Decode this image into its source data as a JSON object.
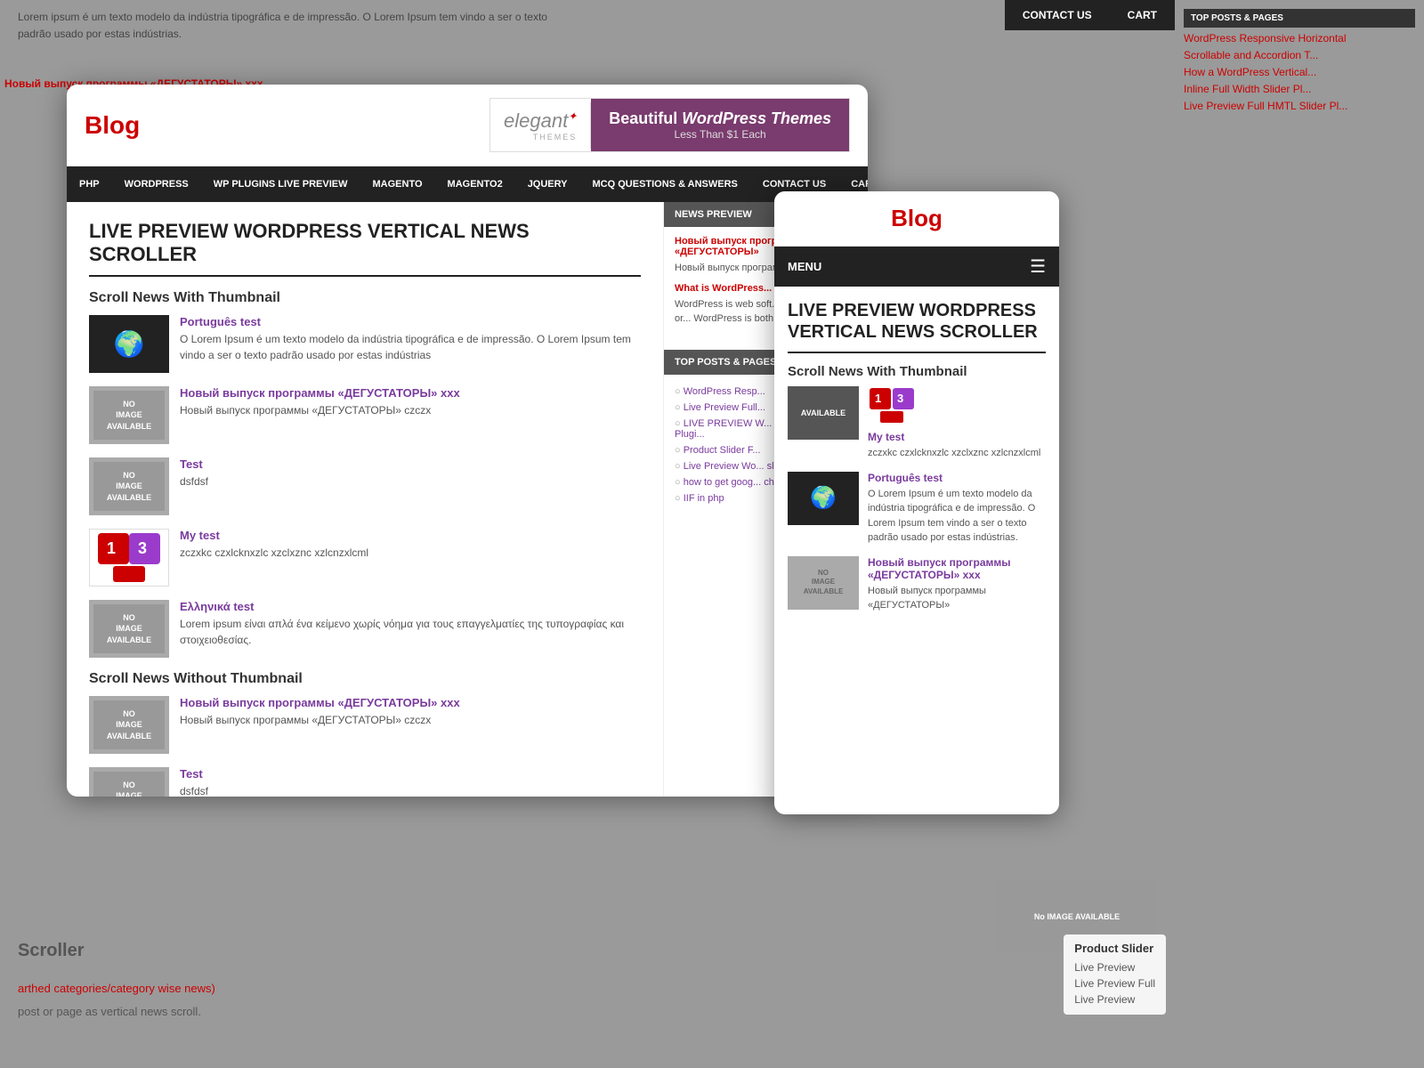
{
  "background": {
    "top_text": "Lorem ipsum é um texto modelo da indústria tipográfica e de impressão. O Lorem Ipsum tem vindo a ser o texto padrão usado por estas indústrias.",
    "red_links": [
      "Новый выпуск программы «ДЕГУСТАТОРЫ» xxx"
    ],
    "right_items": [
      "WordPress Responsive Horizontal",
      "Scrollable and Accordion T...",
      "How a WordPress Vertical...",
      "Inline Full Width Slider Pl...",
      "Live Preview Full HMTL Slider Pl..."
    ]
  },
  "contact_cart": {
    "contact_label": "CONTACT US",
    "cart_label": "CART"
  },
  "main_window": {
    "logo": "Blog",
    "banner": {
      "elegant_name": "elegant",
      "elegant_sub": "themes",
      "promo_text": "Beautiful WordPress Themes",
      "promo_sub": "Less Than $1 Each"
    },
    "nav_items": [
      "PHP",
      "WORDPRESS",
      "WP PLUGINS LIVE PREVIEW",
      "MAGENTO",
      "MAGENTO2",
      "JQUERY",
      "MCQ QUESTIONS & ANSWERS",
      "CONTACT US",
      "CART"
    ],
    "article": {
      "title": "LIVE PREVIEW WORDPRESS VERTICAL NEWS SCROLLER",
      "section1": "Scroll News With Thumbnail",
      "news_items_with_thumb": [
        {
          "link": "Português test",
          "text": "O Lorem Ipsum é um texto modelo da indústria tipográfica e de impressão. O Lorem Ipsum tem vindo a ser o texto padrão usado por estas indústrias",
          "thumb_type": "globe"
        },
        {
          "link": "Новый выпуск программы «ДЕГУСТАТОРЫ» xxx",
          "text": "Новый выпуск программы «ДЕГУСТАТОРЫ» czczx",
          "thumb_type": "no-image"
        },
        {
          "link": "Test",
          "text": "dsfdsf",
          "thumb_type": "no-image"
        },
        {
          "link": "My test",
          "text": "zczxkc czxlcknxzlc xzclxznc xzlcnzxlcml",
          "thumb_type": "cube"
        },
        {
          "link": "Ελληνικά test",
          "text": "Lorem ipsum είναι απλά ένα κείμενο χωρίς νόημα για τους επαγγελματίες της τυπογραφίας και στοιχειοθεσίας.",
          "thumb_type": "no-image"
        }
      ],
      "section2": "Scroll News Without Thumbnail",
      "news_items_without_thumb": [
        {
          "link": "Новый выпуск программы «ДЕГУСТАТОРЫ» xxx",
          "text": "Новый выпуск программы «ДЕГУСТАТОРЫ» czczx",
          "thumb_type": "no-image"
        },
        {
          "link": "Test",
          "text": "dsfdsf",
          "thumb_type": "no-image"
        }
      ]
    },
    "sidebar": {
      "news_preview_title": "NEWS PREVIEW",
      "news_preview_items": [
        {
          "link": "Новый выпуск пр...",
          "full_link": "Новый выпуск программы «ДЕГУСТАТОРЫ»",
          "text": "Новый выпуск програм..."
        },
        {
          "link": "What is WordPress...",
          "text": "WordPress is web soft... beautiful website or... WordPress is both fre... time."
        }
      ],
      "top_posts_title": "TOP POSTS & PAGES",
      "top_posts": [
        "WordPress Resp...",
        "Live Preview Full...",
        "LIVE PREVIEW W... Subscription Plugi...",
        "Product Slider F...",
        "Live Preview Wo... slider with Lightbo...",
        "how to get goog... checkbox keys",
        "IIF in php"
      ]
    }
  },
  "mobile_window": {
    "logo": "Blog",
    "menu_label": "MENU",
    "article_title": "LIVE PREVIEW WORDPRESS VERTICAL NEWS SCROLLER",
    "section_heading": "Scroll News With Thumbnail",
    "news_items": [
      {
        "thumb_type": "available",
        "thumb_text": "AVAILABLE",
        "link": "My test",
        "text": "zczxkc czxlcknxzlc xzclxznc xzlcnzxlcml"
      },
      {
        "thumb_type": "globe",
        "link": "Português test",
        "text": "O Lorem Ipsum é um texto modelo da indústria tipográfica e de impressão. O Lorem Ipsum tem vindo a ser o texto padrão usado por estas indústrias."
      },
      {
        "thumb_type": "no-image",
        "thumb_text": "NO IMAGE AVAILABLE",
        "link": "Новый выпуск программы «ДЕГУСТАТОРЫ» xxx",
        "text": "Новый выпуск программы «ДЕГУСТАТОРЫ»"
      }
    ]
  },
  "bottom_right": {
    "no_image_text": "No IMAGE AVAILABLE",
    "product_slider_label": "Product Slider",
    "links": [
      {
        "label": "Live Preview",
        "href": "#"
      },
      {
        "label": "Live Preview Full",
        "href": "#"
      },
      {
        "label": "Live Preview",
        "href": "#"
      }
    ]
  },
  "bg_bottom": {
    "scroller_label": "Scroller",
    "category_text": "arthed categories/category wise news)",
    "post_text": "post or page as vertical news scroll."
  }
}
